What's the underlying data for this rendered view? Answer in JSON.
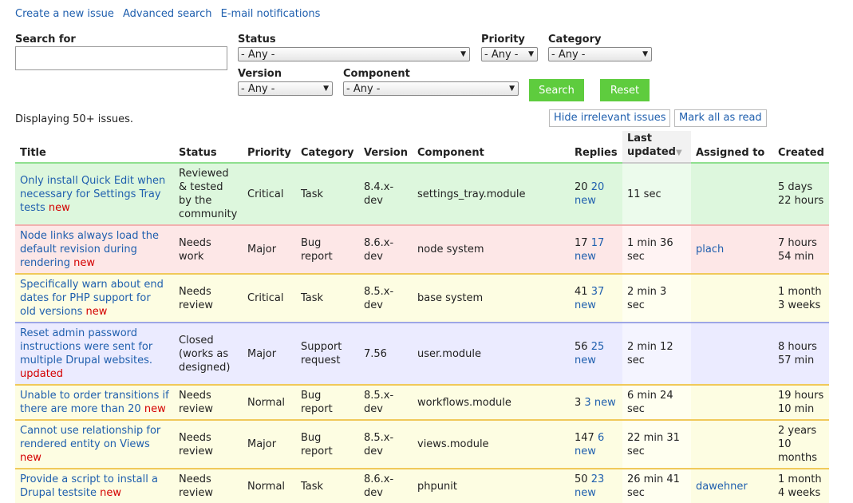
{
  "top_links": [
    "Create a new issue",
    "Advanced search",
    "E-mail notifications"
  ],
  "filters": {
    "search_label": "Search for",
    "search_value": "",
    "status_label": "Status",
    "status_value": "- Any -",
    "priority_label": "Priority",
    "priority_value": "- Any -",
    "category_label": "Category",
    "category_value": "- Any -",
    "version_label": "Version",
    "version_value": "- Any -",
    "component_label": "Component",
    "component_value": "- Any -",
    "search_button": "Search",
    "reset_button": "Reset"
  },
  "displaying": "Displaying 50+ issues.",
  "hide_irrelevant": "Hide irrelevant issues",
  "mark_all_read": "Mark all as read",
  "columns": [
    "Title",
    "Status",
    "Priority",
    "Category",
    "Version",
    "Component",
    "Replies",
    "Last updated",
    "Assigned to",
    "Created"
  ],
  "issues": [
    {
      "title": "Only install Quick Edit when necessary for Settings Tray tests",
      "flag": "new",
      "status": "Reviewed & tested by the community",
      "priority": "Critical",
      "category": "Task",
      "version": "8.4.x-dev",
      "component": "settings_tray.module",
      "replies": "20",
      "replies_new": "20 new",
      "updated": "11 sec",
      "assigned": "",
      "created": "5 days 22 hours",
      "row_color": "green"
    },
    {
      "title": "Node links always load the default revision during rendering",
      "flag": "new",
      "status": "Needs work",
      "priority": "Major",
      "category": "Bug report",
      "version": "8.6.x-dev",
      "component": "node system",
      "replies": "17",
      "replies_new": "17 new",
      "updated": "1 min 36 sec",
      "assigned": "plach",
      "created": "7 hours 54 min",
      "row_color": "red"
    },
    {
      "title": "Specifically warn about end dates for PHP support for old versions",
      "flag": "new",
      "status": "Needs review",
      "priority": "Critical",
      "category": "Task",
      "version": "8.5.x-dev",
      "component": "base system",
      "replies": "41",
      "replies_new": "37 new",
      "updated": "2 min 3 sec",
      "assigned": "",
      "created": "1 month 3 weeks",
      "row_color": "yellow"
    },
    {
      "title": "Reset admin password instructions were sent for multiple Drupal websites.",
      "flag": "updated",
      "status": "Closed (works as designed)",
      "priority": "Major",
      "category": "Support request",
      "version": "7.56",
      "component": "user.module",
      "replies": "56",
      "replies_new": "25 new",
      "updated": "2 min 12 sec",
      "assigned": "",
      "created": "8 hours 57 min",
      "row_color": "purple"
    },
    {
      "title": "Unable to order transitions if there are more than 20",
      "flag": "new",
      "status": "Needs review",
      "priority": "Normal",
      "category": "Bug report",
      "version": "8.5.x-dev",
      "component": "workflows.module",
      "replies": "3",
      "replies_new": "3 new",
      "updated": "6 min 24 sec",
      "assigned": "",
      "created": "19 hours 10 min",
      "row_color": "yellow"
    },
    {
      "title": "Cannot use relationship for rendered entity on Views",
      "flag": "new",
      "status": "Needs review",
      "priority": "Major",
      "category": "Bug report",
      "version": "8.5.x-dev",
      "component": "views.module",
      "replies": "147",
      "replies_new": "6 new",
      "updated": "22 min 31 sec",
      "assigned": "",
      "created": "2 years 10 months",
      "row_color": "yellow"
    },
    {
      "title": "Provide a script to install a Drupal testsite",
      "flag": "new",
      "status": "Needs review",
      "priority": "Normal",
      "category": "Task",
      "version": "8.6.x-dev",
      "component": "phpunit",
      "replies": "50",
      "replies_new": "23 new",
      "updated": "26 min 41 sec",
      "assigned": "dawehner",
      "created": "1 month 4 weeks",
      "row_color": "yellow"
    }
  ]
}
